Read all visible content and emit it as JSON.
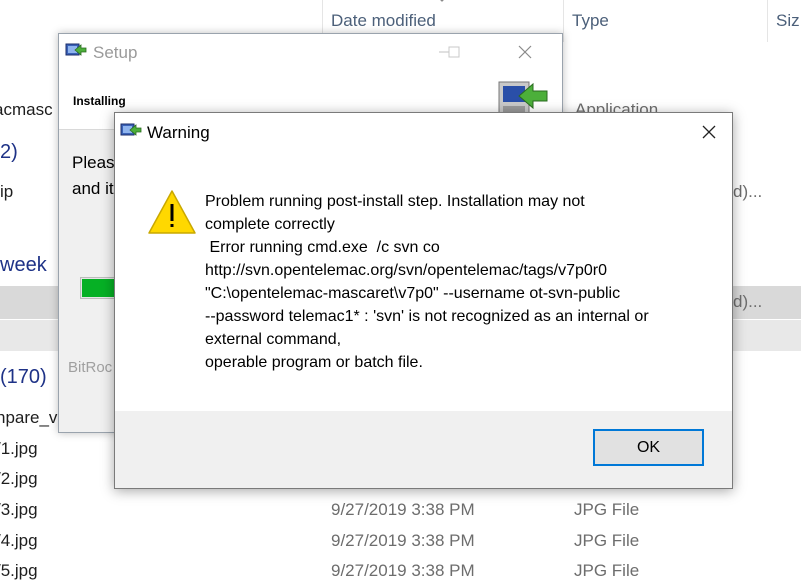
{
  "explorer": {
    "columns": {
      "date_modified": "Date modified",
      "type": "Type",
      "size": "Siz"
    },
    "items": {
      "file_top": "acmasc",
      "file_top_type": "Application",
      "group_1": "2)",
      "file_zip": "ip",
      "file_zip_meta": "d)...",
      "group_week": "week",
      "file_sel_meta": "d)...",
      "group_170": "(170)",
      "file_compare": "npare_v",
      "files": [
        {
          "name": "/1.jpg",
          "date": "",
          "type": ""
        },
        {
          "name": "/2.jpg",
          "date": "",
          "type": ""
        },
        {
          "name": "/3.jpg",
          "date": "9/27/2019 3:38 PM",
          "type": "JPG File"
        },
        {
          "name": "/4.jpg",
          "date": "9/27/2019 3:38 PM",
          "type": "JPG File"
        },
        {
          "name": "/5.jpg",
          "date": "9/27/2019 3:38 PM",
          "type": "JPG File"
        }
      ]
    }
  },
  "setup": {
    "title": "Setup",
    "heading": "Installing",
    "body_line1": "Please",
    "body_line2": "and it",
    "progress_fraction": 0.12,
    "footer": "BitRoc"
  },
  "warning": {
    "title": "Warning",
    "message_lines": [
      "Problem running post-install step. Installation may not",
      "complete correctly",
      " Error running cmd.exe  /c svn co",
      "http://svn.opentelemac.org/svn/opentelemac/tags/v7p0r0",
      "\"C:\\opentelemac-mascaret\\v7p0\" --username ot-svn-public",
      "--password telemac1* : 'svn' is not recognized as an internal or",
      "external command,",
      "operable program or batch file."
    ],
    "ok_label": "OK"
  },
  "colors": {
    "accent": "#0078d7",
    "progress": "#06b025",
    "warning_yellow": "#ffd800"
  }
}
